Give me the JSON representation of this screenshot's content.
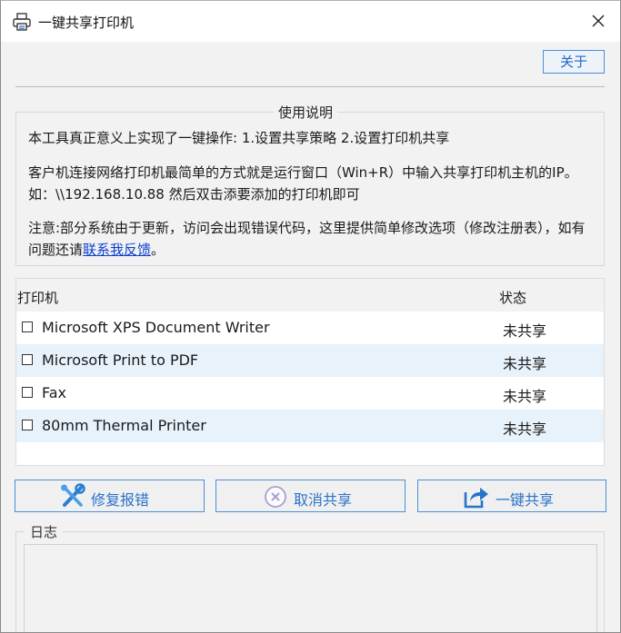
{
  "window": {
    "title": "一键共享打印机"
  },
  "toolbar": {
    "about_label": "关于"
  },
  "usage": {
    "title": "使用说明",
    "line1": "本工具真正意义上实现了一键操作:  1.设置共享策略 2.设置打印机共享",
    "line2": "客户机连接网络打印机最简单的方式就是运行窗口（Win+R）中输入共享打印机主机的IP。如：\\\\192.168.10.88 然后双击添要添加的打印机即可",
    "line3_prefix": "注意:部分系统由于更新，访问会出现错误代码，这里提供简单修改选项（修改注册表），如有问题还请",
    "line3_link": "联系我反馈",
    "line3_suffix": "。"
  },
  "printer_list": {
    "columns": {
      "printer": "打印机",
      "status": "状态"
    },
    "rows": [
      {
        "name": "Microsoft XPS Document Writer",
        "status": "未共享"
      },
      {
        "name": "Microsoft Print to PDF",
        "status": "未共享"
      },
      {
        "name": "Fax",
        "status": "未共享"
      },
      {
        "name": "80mm Thermal Printer",
        "status": "未共享"
      }
    ]
  },
  "actions": {
    "repair_label": "修复报错",
    "cancel_label": "取消共享",
    "share_label": "一键共享"
  },
  "log": {
    "title": "日志"
  },
  "icons": {
    "title": "printer-icon",
    "close": "close-icon",
    "repair": "wrench-icon",
    "cancel": "cancel-circle-icon",
    "share": "share-icon"
  },
  "colors": {
    "accent": "#2a72c9",
    "row_alt": "#e8f2fa",
    "link": "#0b3fd0"
  }
}
